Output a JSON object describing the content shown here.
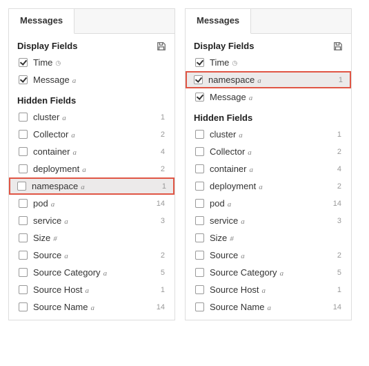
{
  "panels": [
    {
      "tab_label": "Messages",
      "display_header": "Display Fields",
      "hidden_header": "Hidden Fields",
      "display_fields": [
        {
          "name": "time",
          "label": "Time",
          "type": "clock",
          "checked": true,
          "count": ""
        },
        {
          "name": "message",
          "label": "Message",
          "type": "a",
          "checked": true,
          "count": ""
        }
      ],
      "hidden_fields": [
        {
          "name": "cluster",
          "label": "cluster",
          "type": "a",
          "checked": false,
          "count": "1"
        },
        {
          "name": "collector",
          "label": "Collector",
          "type": "a",
          "checked": false,
          "count": "2"
        },
        {
          "name": "container",
          "label": "container",
          "type": "a",
          "checked": false,
          "count": "4"
        },
        {
          "name": "deployment",
          "label": "deployment",
          "type": "a",
          "checked": false,
          "count": "2"
        },
        {
          "name": "namespace",
          "label": "namespace",
          "type": "a",
          "checked": false,
          "count": "1",
          "highlight": true
        },
        {
          "name": "pod",
          "label": "pod",
          "type": "a",
          "checked": false,
          "count": "14"
        },
        {
          "name": "service",
          "label": "service",
          "type": "a",
          "checked": false,
          "count": "3"
        },
        {
          "name": "size",
          "label": "Size",
          "type": "#",
          "checked": false,
          "count": ""
        },
        {
          "name": "source",
          "label": "Source",
          "type": "a",
          "checked": false,
          "count": "2"
        },
        {
          "name": "source-category",
          "label": "Source Category",
          "type": "a",
          "checked": false,
          "count": "5"
        },
        {
          "name": "source-host",
          "label": "Source Host",
          "type": "a",
          "checked": false,
          "count": "1"
        },
        {
          "name": "source-name",
          "label": "Source Name",
          "type": "a",
          "checked": false,
          "count": "14"
        }
      ]
    },
    {
      "tab_label": "Messages",
      "display_header": "Display Fields",
      "hidden_header": "Hidden Fields",
      "display_fields": [
        {
          "name": "time",
          "label": "Time",
          "type": "clock",
          "checked": true,
          "count": ""
        },
        {
          "name": "namespace",
          "label": "namespace",
          "type": "a",
          "checked": true,
          "count": "1",
          "highlight": true
        },
        {
          "name": "message",
          "label": "Message",
          "type": "a",
          "checked": true,
          "count": ""
        }
      ],
      "hidden_fields": [
        {
          "name": "cluster",
          "label": "cluster",
          "type": "a",
          "checked": false,
          "count": "1"
        },
        {
          "name": "collector",
          "label": "Collector",
          "type": "a",
          "checked": false,
          "count": "2"
        },
        {
          "name": "container",
          "label": "container",
          "type": "a",
          "checked": false,
          "count": "4"
        },
        {
          "name": "deployment",
          "label": "deployment",
          "type": "a",
          "checked": false,
          "count": "2"
        },
        {
          "name": "pod",
          "label": "pod",
          "type": "a",
          "checked": false,
          "count": "14"
        },
        {
          "name": "service",
          "label": "service",
          "type": "a",
          "checked": false,
          "count": "3"
        },
        {
          "name": "size",
          "label": "Size",
          "type": "#",
          "checked": false,
          "count": ""
        },
        {
          "name": "source",
          "label": "Source",
          "type": "a",
          "checked": false,
          "count": "2"
        },
        {
          "name": "source-category",
          "label": "Source Category",
          "type": "a",
          "checked": false,
          "count": "5"
        },
        {
          "name": "source-host",
          "label": "Source Host",
          "type": "a",
          "checked": false,
          "count": "1"
        },
        {
          "name": "source-name",
          "label": "Source Name",
          "type": "a",
          "checked": false,
          "count": "14"
        }
      ]
    }
  ],
  "glyphs": {
    "a": "a",
    "clock": "◷",
    "#": "#"
  }
}
